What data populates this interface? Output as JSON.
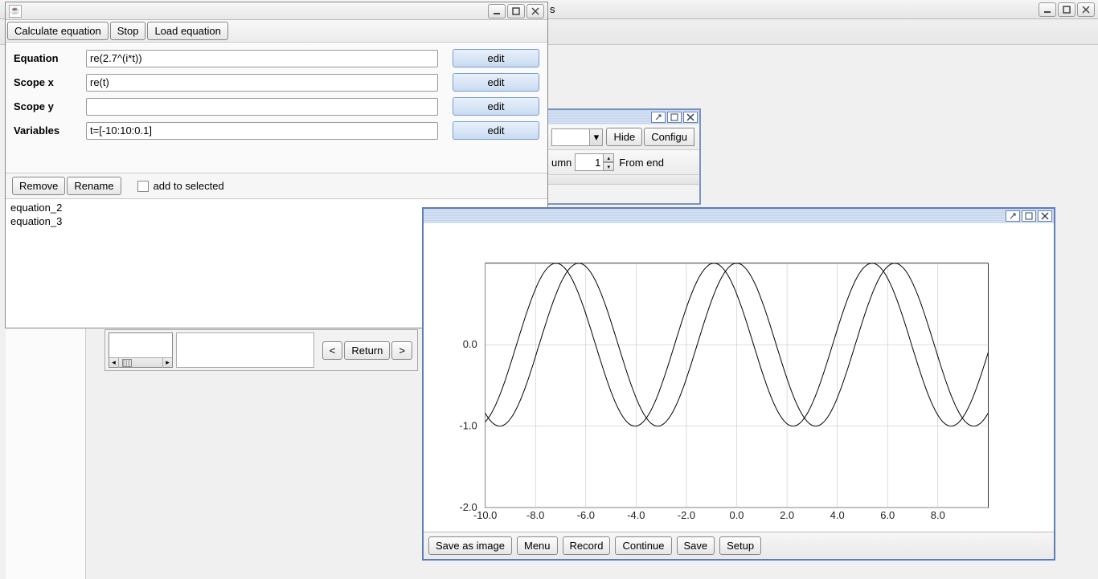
{
  "back": {
    "suffix": "s"
  },
  "eqwin": {
    "toolbar": {
      "calc": "Calculate equation",
      "stop": "Stop",
      "load": "Load equation"
    },
    "rows": {
      "equation": {
        "label": "Equation",
        "value": "re(2.7^(i*t))",
        "edit": "edit"
      },
      "scopex": {
        "label": "Scope x",
        "value": "re(t)",
        "edit": "edit"
      },
      "scopey": {
        "label": "Scope y",
        "value": "",
        "edit": "edit"
      },
      "vars": {
        "label": "Variables",
        "value": "t=[-10:10:0.1]",
        "edit": "edit"
      }
    },
    "mid": {
      "remove": "Remove",
      "rename": "Rename",
      "add_chk": "add to selected"
    },
    "list": [
      "equation_2",
      "equation_3"
    ]
  },
  "panel2": {
    "hide": "Hide",
    "config": "Configu",
    "col_label": "umn",
    "col_value": "1",
    "from_end": "From end"
  },
  "nav": {
    "back": "<",
    "ret": "Return",
    "fwd": ">"
  },
  "plot": {
    "footer": {
      "saveimg": "Save as image",
      "menu": "Menu",
      "record": "Record",
      "continue": "Continue",
      "save": "Save",
      "setup": "Setup"
    }
  },
  "chart_data": {
    "type": "line",
    "xlim": [
      -10,
      10
    ],
    "ylim": [
      -2.0,
      1.0
    ],
    "xticks": [
      -10,
      -8,
      -6,
      -4,
      -2,
      0,
      2,
      4,
      6,
      8
    ],
    "yticks": [
      -2.0,
      -1.0,
      0.0
    ],
    "series": [
      {
        "name": "re(2.7^(i*t))",
        "expr": "cos(t)",
        "phase": 0.0
      },
      {
        "name": "equation_2",
        "expr": "cos(t)",
        "phase": 0.9
      }
    ],
    "sample_step": 0.1
  }
}
